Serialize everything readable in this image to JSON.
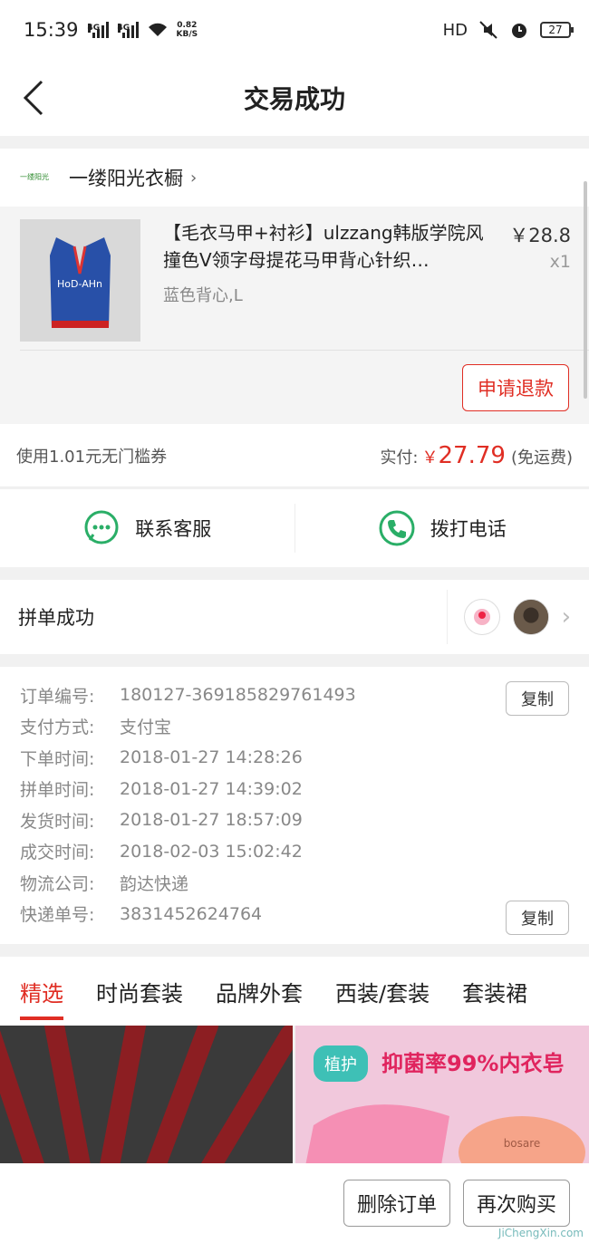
{
  "status_bar": {
    "time": "15:39",
    "net1": "4G",
    "net2": "4G",
    "speed_value": "0.82",
    "speed_unit": "KB/S",
    "hd": "HD",
    "battery": "27"
  },
  "nav": {
    "title": "交易成功"
  },
  "shop": {
    "logo_text": "一缕阳光",
    "name": "一缕阳光衣橱"
  },
  "product": {
    "image_text": "HoD-AHn",
    "title": "【毛衣马甲+衬衫】ulzzang韩版学院风撞色V领字母提花马甲背心针织…",
    "spec": "蓝色背心,L",
    "price": "￥28.8",
    "qty": "x1",
    "refund_label": "申请退款"
  },
  "payment": {
    "coupon": "使用1.01元无门槛券",
    "paid_label": "实付:",
    "currency": "￥",
    "paid_amount": "27.79",
    "shipping_note": "(免运费)"
  },
  "contact": {
    "service_label": "联系客服",
    "phone_label": "拨打电话"
  },
  "group": {
    "label": "拼单成功"
  },
  "order_info": {
    "rows": [
      {
        "label": "订单编号:",
        "value": "180127-369185829761493"
      },
      {
        "label": "支付方式:",
        "value": "支付宝"
      },
      {
        "label": "下单时间:",
        "value": "2018-01-27 14:28:26"
      },
      {
        "label": "拼单时间:",
        "value": "2018-01-27 14:39:02"
      },
      {
        "label": "发货时间:",
        "value": "2018-01-27 18:57:09"
      },
      {
        "label": "成交时间:",
        "value": "2018-02-03 15:02:42"
      },
      {
        "label": "物流公司:",
        "value": "韵达快递"
      },
      {
        "label": "快递单号:",
        "value": "3831452624764"
      }
    ],
    "copy_label": "复制"
  },
  "tabs": [
    "精选",
    "时尚套装",
    "品牌外套",
    "西装/套装",
    "套装裙"
  ],
  "banner_right": {
    "brand": "植护",
    "headline": "抑菌率99%内衣皂",
    "product_text": "bosare"
  },
  "bottom": {
    "delete_label": "删除订单",
    "rebuy_label": "再次购买"
  },
  "watermark": "JiChengXin.com",
  "colors": {
    "accent": "#e02e24",
    "wechat_green": "#2aae67"
  }
}
